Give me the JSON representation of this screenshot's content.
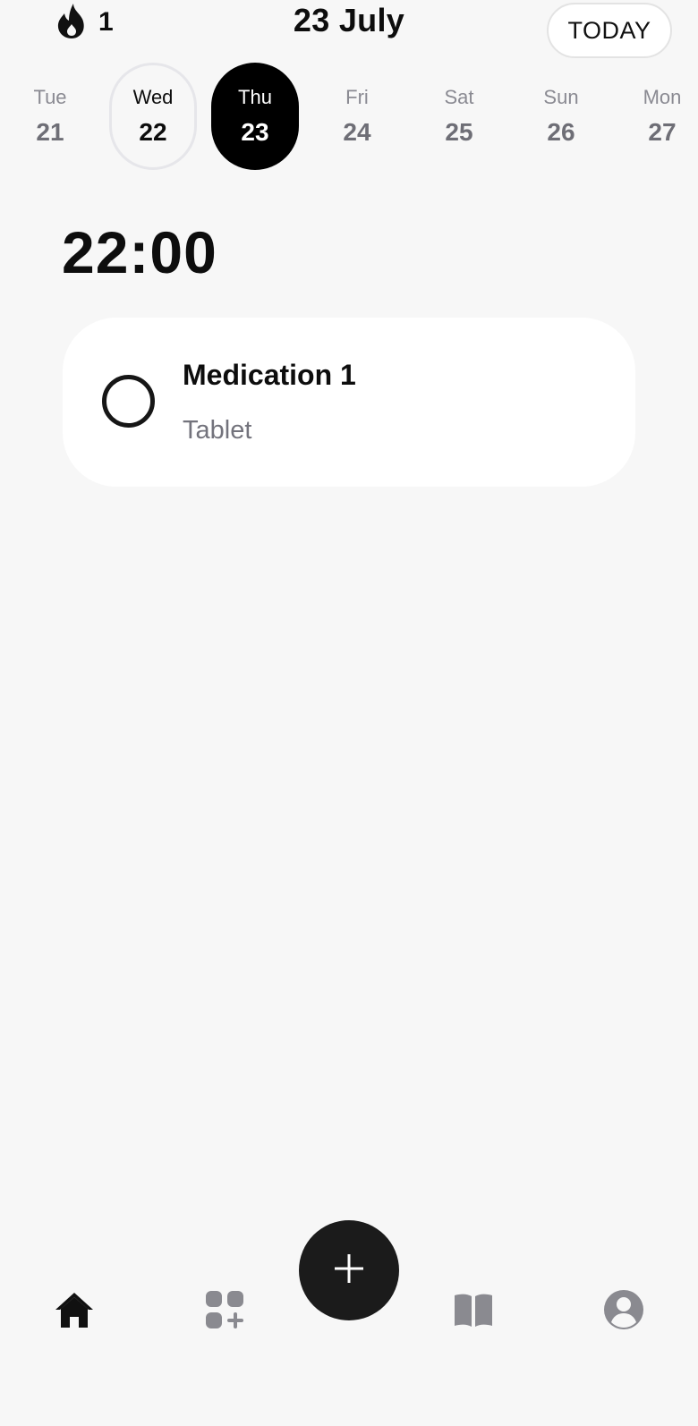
{
  "header": {
    "streak_icon": "flame-icon",
    "streak_count": "1",
    "date_title": "23 July",
    "today_label": "TODAY"
  },
  "days": [
    {
      "name": "Tue",
      "num": "21",
      "state": "default"
    },
    {
      "name": "Wed",
      "num": "22",
      "state": "outlined"
    },
    {
      "name": "Thu",
      "num": "23",
      "state": "selected"
    },
    {
      "name": "Fri",
      "num": "24",
      "state": "default"
    },
    {
      "name": "Sat",
      "num": "25",
      "state": "default"
    },
    {
      "name": "Sun",
      "num": "26",
      "state": "default"
    },
    {
      "name": "Mon",
      "num": "27",
      "state": "default"
    }
  ],
  "schedule": {
    "time": "22:00",
    "medication": {
      "name": "Medication 1",
      "form": "Tablet",
      "taken": false
    }
  },
  "nav": {
    "items": [
      {
        "icon": "home-icon",
        "active": true
      },
      {
        "icon": "add-apps-icon",
        "active": false
      },
      {
        "icon": "add-icon",
        "active": false
      },
      {
        "icon": "book-icon",
        "active": false
      },
      {
        "icon": "profile-icon",
        "active": false
      }
    ]
  },
  "colors": {
    "background": "#f7f7f7",
    "accent": "#000000",
    "muted_text": "#73737c",
    "inactive_icon": "#8a8a90"
  }
}
